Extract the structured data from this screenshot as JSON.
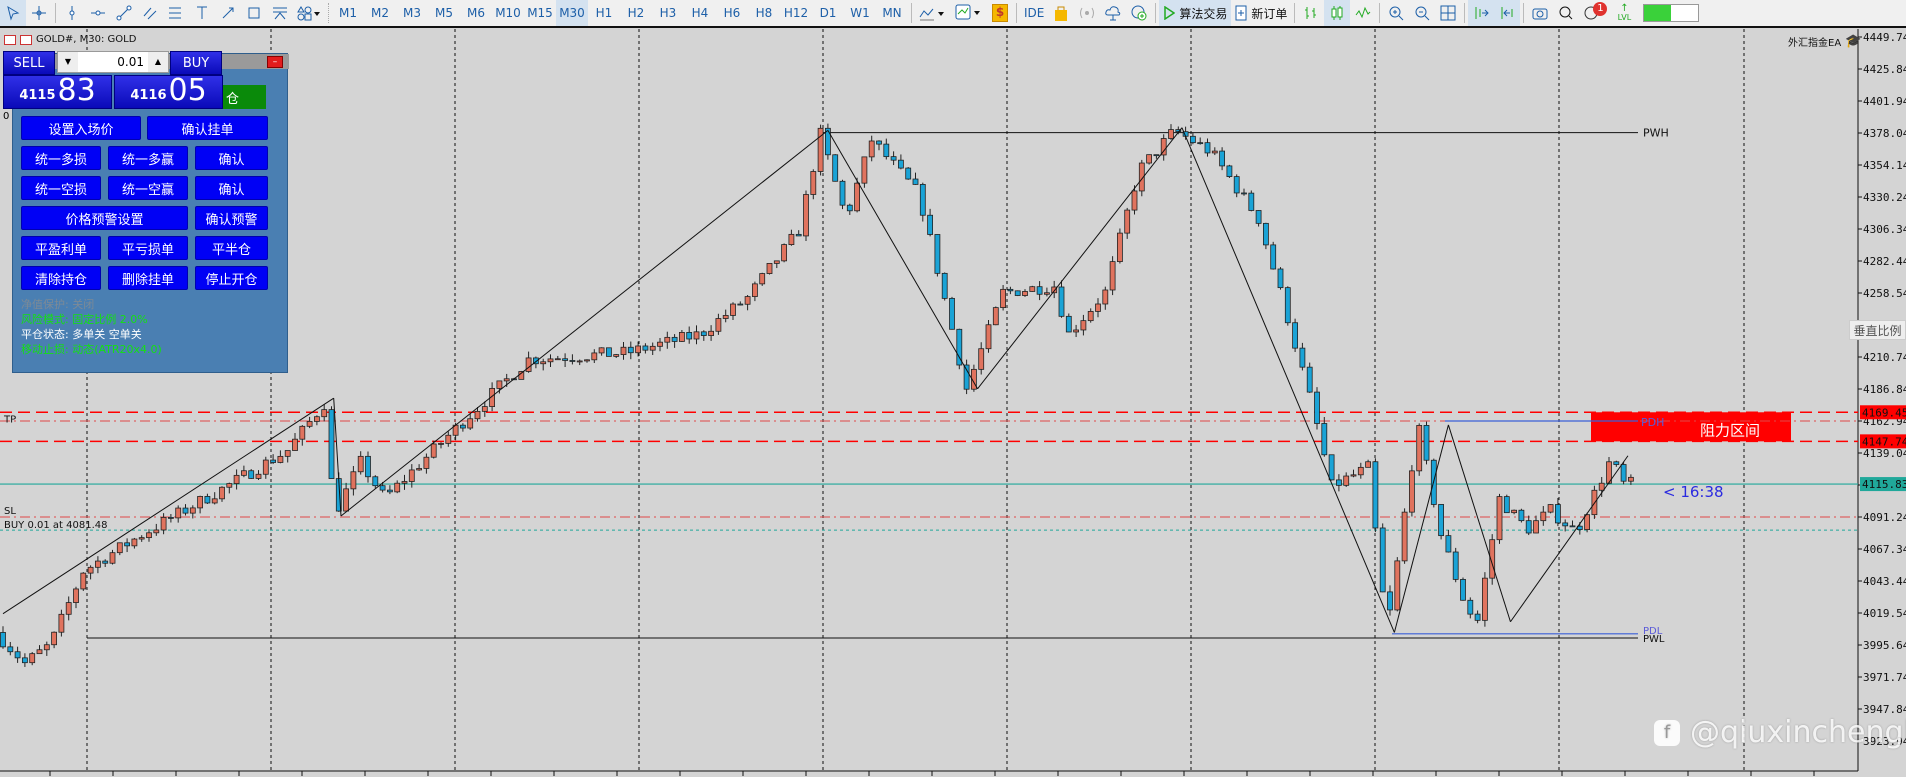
{
  "toolbar": {
    "timeframes": [
      "M1",
      "M2",
      "M3",
      "M5",
      "M6",
      "M10",
      "M15",
      "M30",
      "H1",
      "H2",
      "H3",
      "H4",
      "H6",
      "H8",
      "H12",
      "D1",
      "W1",
      "MN"
    ],
    "active_timeframe": "M30",
    "ide_label": "IDE",
    "algo_trading_label": "算法交易",
    "new_order_label": "新订单",
    "notification_count": "1",
    "lvl_label": "LVL",
    "dollar_label": "$"
  },
  "chart": {
    "title": "GOLD#, M30:  GOLD",
    "ea_label": "外汇指金EA",
    "axis_labels": [
      "4449.74",
      "4425.84",
      "4401.94",
      "4378.04",
      "4354.14",
      "4330.24",
      "4306.34",
      "4282.44",
      "4258.54",
      "4234.64",
      "4210.74",
      "4186.84",
      "4162.94",
      "4139.04",
      "4115.14",
      "4091.24",
      "4067.34",
      "4043.44",
      "4019.54",
      "3995.64",
      "3971.74",
      "3947.84",
      "3923.94"
    ],
    "axis_max": 4449.74,
    "axis_min": 3923.94,
    "current_price": "4115.83",
    "tp_price": "4169.45",
    "zone_low_price": "4147.74",
    "countdown": "< 16:38",
    "labels": {
      "pwh": "PWH",
      "pwl": "PWL",
      "pdh": "PDH",
      "pdl": "PDL",
      "tp": "TP",
      "sl": "SL",
      "position": "BUY 0.01 at 4081.48",
      "zone": "阻力区间"
    },
    "levels": {
      "pwh": 4378.3,
      "pwl": 4000.9,
      "pdh": 4162.94,
      "pdl": 4004.0,
      "tp": 4169.45,
      "zone_low": 4147.74,
      "sl": 4091.24,
      "entry": 4081.48,
      "bid": 4115.83
    },
    "vertical_scale_tooltip": "垂直比例",
    "price_path": [
      [
        0,
        4005
      ],
      [
        4,
        3982
      ],
      [
        7.5,
        3996
      ],
      [
        12,
        4051
      ],
      [
        20,
        4078
      ],
      [
        31.6,
        4114
      ],
      [
        40,
        4141
      ],
      [
        45.3,
        4178
      ],
      [
        46.3,
        4092
      ],
      [
        50,
        4132
      ],
      [
        53.3,
        4105
      ],
      [
        61.6,
        4150
      ],
      [
        73,
        4209
      ],
      [
        86.6,
        4214
      ],
      [
        96.6,
        4228
      ],
      [
        103,
        4255
      ],
      [
        110,
        4305
      ],
      [
        113,
        4377
      ],
      [
        116.5,
        4314
      ],
      [
        120,
        4373
      ],
      [
        126.5,
        4332
      ],
      [
        133,
        4187
      ],
      [
        138,
        4259
      ],
      [
        145,
        4264
      ],
      [
        147,
        4228
      ],
      [
        152,
        4259
      ],
      [
        156.6,
        4350
      ],
      [
        161.5,
        4380
      ],
      [
        166.5,
        4364
      ],
      [
        173,
        4314
      ],
      [
        176.5,
        4250
      ],
      [
        180.6,
        4169
      ],
      [
        183,
        4114
      ],
      [
        188,
        4128
      ],
      [
        190.6,
        4005
      ],
      [
        194.8,
        4160
      ],
      [
        198,
        4078
      ],
      [
        201.5,
        4023
      ],
      [
        203,
        4014
      ],
      [
        206,
        4105
      ],
      [
        209.8,
        4082
      ],
      [
        213,
        4096
      ],
      [
        216.5,
        4080
      ],
      [
        221.5,
        4137
      ],
      [
        222.6,
        4114
      ],
      [
        223,
        4116
      ]
    ],
    "zigzag": [
      [
        0,
        4019
      ],
      [
        45.3,
        4180
      ],
      [
        46.3,
        4092
      ],
      [
        113,
        4380
      ],
      [
        133.5,
        4187
      ],
      [
        161.5,
        4382
      ],
      [
        190.6,
        4005
      ],
      [
        198,
        4160
      ],
      [
        206.5,
        4013
      ],
      [
        222.6,
        4137
      ]
    ],
    "colors": {
      "bull": "#e0735e",
      "bear": "#1aa3d6",
      "tp": "#ff0000",
      "current": "#20a89a",
      "pdh": "#3a5fd8",
      "zone": "#ff0000"
    }
  },
  "panel": {
    "sell_label": "SELL",
    "buy_label": "BUY",
    "lot": "0.01",
    "sell_price_small": "4115",
    "sell_price_large": "83",
    "buy_price_small": "4116",
    "buy_price_large": "05",
    "green_button": "仓",
    "left_marker": "0",
    "buttons": [
      "设置入场价",
      "确认挂单",
      "统一多损",
      "统一多赢",
      "确认",
      "统一空损",
      "统一空赢",
      "确认",
      "价格预警设置",
      "确认预警",
      "平盈利单",
      "平亏损单",
      "平半仓",
      "清除持仓",
      "删除挂单",
      "停止开仓"
    ],
    "status": [
      "净值保护: 关闭",
      "风险模式: 固定比例 2.0%",
      "平仓状态: 多单关 空单关",
      "移动止损: 动态(ATR20x4.0)"
    ]
  },
  "watermark": "@qiuxinchengl"
}
